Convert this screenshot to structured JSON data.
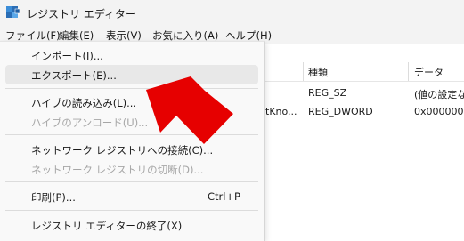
{
  "window": {
    "title": "レジストリ エディター"
  },
  "menubar": {
    "items": [
      {
        "label": "ファイル(F)"
      },
      {
        "label": "編集(E)"
      },
      {
        "label": "表示(V)"
      },
      {
        "label": "お気に入り(A)"
      },
      {
        "label": "ヘルプ(H)"
      }
    ]
  },
  "columns": {
    "type": "種類",
    "data": "データ"
  },
  "rows": [
    {
      "name": "",
      "type": "REG_SZ",
      "data": "(値の設定な"
    },
    {
      "name": "tKno...",
      "type": "REG_DWORD",
      "data": "0x0000000"
    }
  ],
  "file_menu": {
    "items": [
      {
        "label": "インポート(I)...",
        "enabled": true
      },
      {
        "label": "エクスポート(E)...",
        "enabled": true,
        "highlighted": true
      },
      {
        "label": "ハイブの読み込み(L)...",
        "enabled": true
      },
      {
        "label": "ハイブのアンロード(U)...",
        "enabled": false
      },
      {
        "label": "ネットワーク レジストリへの接続(C)...",
        "enabled": true
      },
      {
        "label": "ネットワーク レジストリの切断(D)...",
        "enabled": false
      },
      {
        "label": "印刷(P)...",
        "enabled": true,
        "shortcut": "Ctrl+P"
      },
      {
        "label": "レジストリ エディターの終了(X)",
        "enabled": true
      }
    ]
  },
  "annotation": {
    "arrow_color": "#e60000",
    "points_to": "エクスポート(E)..."
  },
  "colors": {
    "menu_background": "#f9f9f9",
    "menu_hover": "#e8e8e8",
    "disabled_text": "#a6a6a6",
    "app_icon": "#3b8dd8"
  }
}
